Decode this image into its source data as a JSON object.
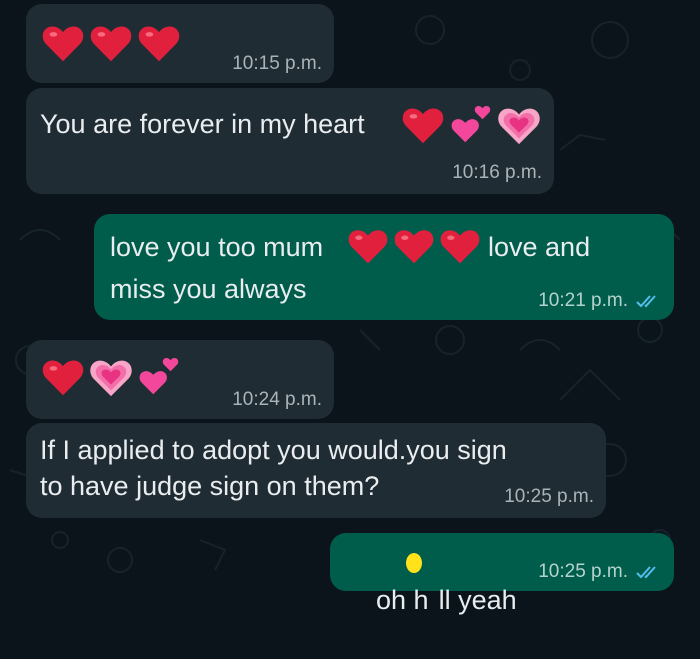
{
  "chat": {
    "messages": [
      {
        "direction": "incoming",
        "emoji": [
          "red-heart",
          "red-heart",
          "red-heart"
        ],
        "time": "10:15 p.m."
      },
      {
        "direction": "incoming",
        "text": "You are forever in my heart",
        "emoji": [
          "red-heart",
          "two-hearts",
          "growing-heart"
        ],
        "time": "10:16 p.m."
      },
      {
        "direction": "outgoing",
        "text_part1": "love you too mum",
        "emoji": [
          "red-heart",
          "red-heart",
          "red-heart"
        ],
        "text_part2": "love and",
        "text_line2": "miss you always",
        "time": "10:21 p.m.",
        "status": "read"
      },
      {
        "direction": "incoming",
        "emoji": [
          "red-heart",
          "growing-heart",
          "two-hearts"
        ],
        "time": "10:24 p.m."
      },
      {
        "direction": "incoming",
        "text_line1": "If I applied to adopt you would.you sign",
        "text_line2": "to have judge sign on them?",
        "time": "10:25 p.m."
      },
      {
        "direction": "outgoing",
        "text_a": "oh h",
        "text_b": "ll yeah",
        "time": "10:25 p.m.",
        "status": "read",
        "redaction_color": "#ffe21a"
      }
    ]
  },
  "colors": {
    "background": "#0b141a",
    "incoming_bubble": "#202c33",
    "outgoing_bubble": "#005c4b",
    "read_ticks": "#53bdeb"
  },
  "icons": {
    "red_heart": "red-heart-icon",
    "two_hearts": "two-hearts-icon",
    "growing_heart": "growing-heart-icon",
    "read_receipt": "double-check-icon"
  }
}
